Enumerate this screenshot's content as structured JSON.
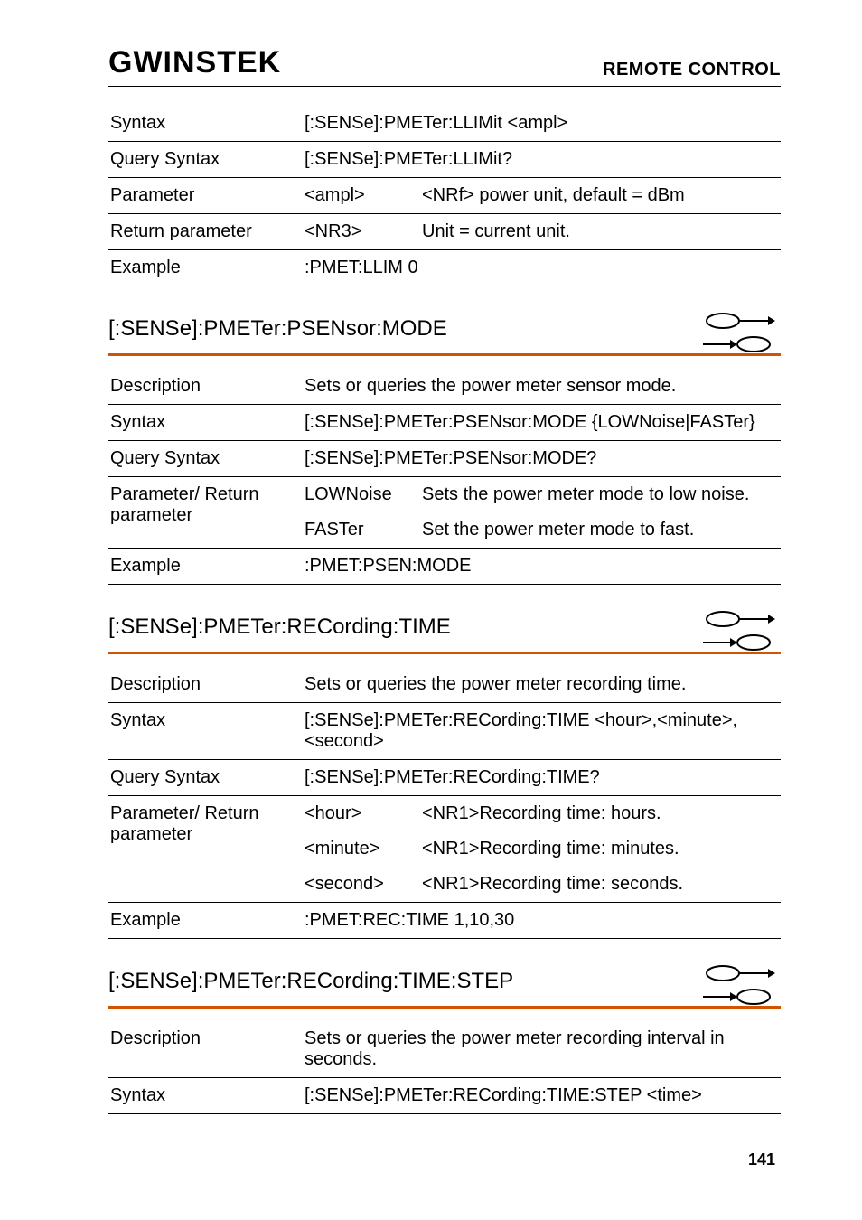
{
  "header": {
    "logo": "GWINSTEK",
    "section": "REMOTE CONTROL"
  },
  "block1": {
    "rows": {
      "syntax_k": "Syntax",
      "syntax_v": "[:SENSe]:PMETer:LLIMit <ampl>",
      "qsyntax_k": "Query Syntax",
      "qsyntax_v": "[:SENSe]:PMETer:LLIMit?",
      "param_k": "Parameter",
      "param_p": "<ampl>",
      "param_v": "<NRf> power unit, default = dBm",
      "ret_k": "Return parameter",
      "ret_p": "<NR3>",
      "ret_v": "Unit = current unit.",
      "ex_k": "Example",
      "ex_v": ":PMET:LLIM 0"
    }
  },
  "sec1": {
    "title": "[:SENSe]:PMETer:PSENsor:MODE",
    "desc_k": "Description",
    "desc_v": "Sets or queries the power meter sensor mode.",
    "syntax_k": "Syntax",
    "syntax_v": "[:SENSe]:PMETer:PSENsor:MODE {LOWNoise|FASTer}",
    "qsyntax_k": "Query Syntax",
    "qsyntax_v": "[:SENSe]:PMETer:PSENsor:MODE?",
    "pr_k": "Parameter/ Return parameter",
    "p1": "LOWNoise",
    "v1": "Sets the power meter mode to low noise.",
    "p2": "FASTer",
    "v2": "Set the power meter mode to fast.",
    "ex_k": "Example",
    "ex_v": ":PMET:PSEN:MODE"
  },
  "sec2": {
    "title": "[:SENSe]:PMETer:RECording:TIME",
    "desc_k": "Description",
    "desc_v": "Sets or queries the power meter recording time.",
    "syntax_k": "Syntax",
    "syntax_v": "[:SENSe]:PMETer:RECording:TIME <hour>,<minute>,<second>",
    "qsyntax_k": "Query Syntax",
    "qsyntax_v": "[:SENSe]:PMETer:RECording:TIME?",
    "pr_k": "Parameter/ Return parameter",
    "p1": "<hour>",
    "v1": "<NR1>Recording time: hours.",
    "p2": "<minute>",
    "v2": "<NR1>Recording time: minutes.",
    "p3": "<second>",
    "v3": "<NR1>Recording time: seconds.",
    "ex_k": "Example",
    "ex_v": ":PMET:REC:TIME 1,10,30"
  },
  "sec3": {
    "title": "[:SENSe]:PMETer:RECording:TIME:STEP",
    "desc_k": "Description",
    "desc_v": "Sets or queries the power meter recording interval in seconds.",
    "syntax_k": "Syntax",
    "syntax_v": "[:SENSe]:PMETer:RECording:TIME:STEP <time>"
  },
  "footer": {
    "page": "141"
  }
}
